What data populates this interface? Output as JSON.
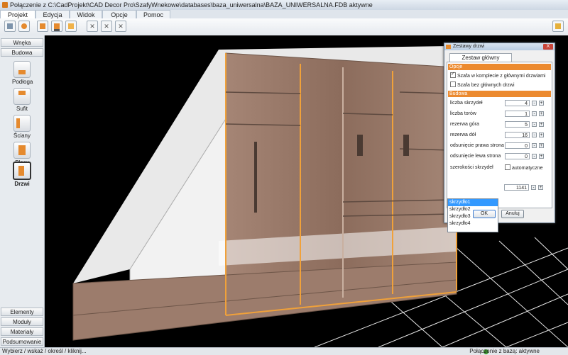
{
  "title": "Połączenie z C:\\CadProjekt\\CAD Decor Pro\\SzafyWnekowe\\databases\\baza_uniwersalna\\BAZA_UNIWERSALNA.FDB aktywne",
  "menu": [
    "Projekt",
    "Edycja",
    "Widok",
    "Opcje",
    "Pomoc"
  ],
  "toolbar_icons": [
    "grid-icon",
    "user-icon",
    "new-file-icon",
    "save-icon",
    "open-folder-icon",
    "remove-icon",
    "remove-all-icon",
    "remove-last-icon",
    "calculator-icon"
  ],
  "sidebar": {
    "top": [
      "Wnęka",
      "Budowa"
    ],
    "items": [
      "Podłoga",
      "Sufit",
      "Ściany",
      "Plecy",
      "Drzwi"
    ],
    "bottom": [
      "Elementy",
      "Moduły",
      "Materiały",
      "Podsumowanie"
    ]
  },
  "status": {
    "left": "Wybierz / wskaż / określ / kliknij...",
    "right": "Połączenie z bazą: aktywne"
  },
  "dialog": {
    "title": "Zestawy drzwi",
    "close": "X",
    "tab": "Zestaw główny",
    "options_header": "Opcje",
    "check1": "Szafa w komplecie z głównymi drzwiami",
    "check2": "Szafa bez głównych drzwi",
    "build_header": "Budowa",
    "fields": [
      {
        "label": "liczba skrzydeł",
        "value": "4"
      },
      {
        "label": "liczba torów",
        "value": "1"
      },
      {
        "label": "rezerwa góra",
        "value": "5"
      },
      {
        "label": "rezerwa dół",
        "value": "16"
      },
      {
        "label": "odsunięcie prawa strona",
        "value": "0"
      },
      {
        "label": "odsunięcie lewa strona",
        "value": "0"
      }
    ],
    "widths_label": "szerokości skrzydeł",
    "auto_label": "automatyczne",
    "leaves": [
      "skrzydło1",
      "skrzydło2",
      "skrzydło3",
      "skrzydło4"
    ],
    "leaf_width": "1141",
    "minus": "-",
    "plus": "+",
    "ok": "OK",
    "cancel": "Anuluj"
  },
  "colors": {
    "accent": "#ec8a2f",
    "wood": "#8f6f5f",
    "selection": "#3399ff"
  }
}
